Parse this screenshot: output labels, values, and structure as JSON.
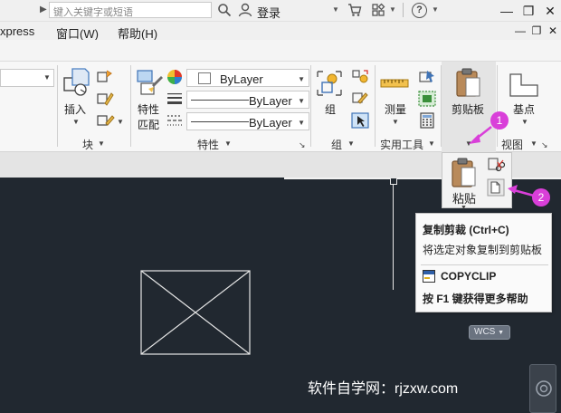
{
  "titlebar": {
    "search_placeholder": "键入关键字或短语",
    "login_label": "登录",
    "icons": [
      "search-icon",
      "user-icon",
      "cart-icon",
      "apps-icon",
      "help-icon"
    ],
    "help_glyph": "?",
    "window_buttons": [
      "—",
      "❐",
      "✕"
    ]
  },
  "menubar": {
    "items": [
      "xpress",
      "窗口(W)",
      "帮助(H)"
    ],
    "mdi_buttons": [
      "—",
      "❐",
      "✕"
    ]
  },
  "ribbon": {
    "block_panel": {
      "insert_label": "插入",
      "title": "块"
    },
    "properties_panel": {
      "match_label_1": "特性",
      "match_label_2": "匹配",
      "color_value": "ByLayer",
      "lineweight_value": "ByLayer",
      "linetype_value": "ByLayer",
      "title": "特性"
    },
    "groups_panel": {
      "group_label": "组",
      "title": "组"
    },
    "utilities_panel": {
      "measure_label": "测量",
      "title": "实用工具"
    },
    "clipboard_panel": {
      "label": "剪贴板"
    },
    "view_panel": {
      "base_label": "基点",
      "title": "视图"
    }
  },
  "paste_panel": {
    "paste_label": "粘贴"
  },
  "tooltip": {
    "title": "复制剪裁 (Ctrl+C)",
    "description": "将选定对象复制到剪贴板",
    "command": "COPYCLIP",
    "help": "按 F1 键获得更多帮助"
  },
  "canvas": {
    "wcs_label": "WCS",
    "watermark": "软件自学网：rjzxw.com",
    "background_color": "#212830"
  },
  "callouts": [
    "1",
    "2"
  ],
  "colors": {
    "callout": "#d93fd9",
    "canvas": "#212830",
    "tooltip_bg": "#fafafa"
  }
}
